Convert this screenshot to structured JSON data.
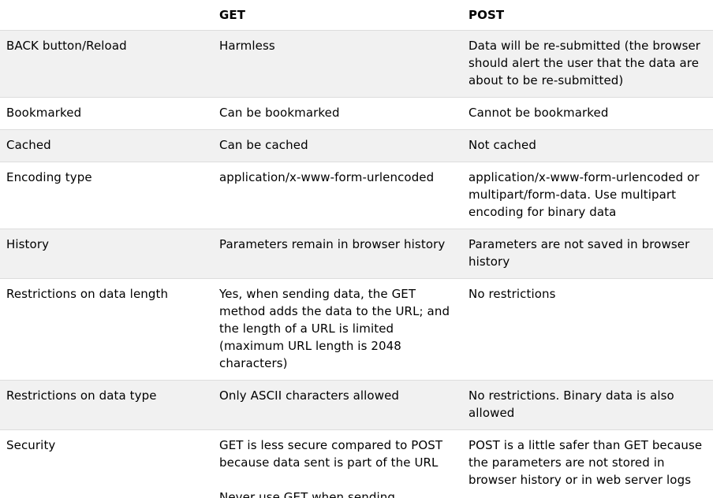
{
  "table": {
    "headers": [
      "",
      "GET",
      "POST"
    ],
    "rows": [
      {
        "label": "BACK button/Reload",
        "get": [
          "Harmless"
        ],
        "post": [
          "Data will be re-submitted (the browser should alert the user that the data are about to be re-submitted)"
        ]
      },
      {
        "label": "Bookmarked",
        "get": [
          "Can be bookmarked"
        ],
        "post": [
          "Cannot be bookmarked"
        ]
      },
      {
        "label": "Cached",
        "get": [
          "Can be cached"
        ],
        "post": [
          "Not cached"
        ]
      },
      {
        "label": "Encoding type",
        "get": [
          "application/x-www-form-urlencoded"
        ],
        "post": [
          "application/x-www-form-urlencoded or multipart/form-data. Use multipart encoding for binary data"
        ]
      },
      {
        "label": "History",
        "get": [
          "Parameters remain in browser history"
        ],
        "post": [
          "Parameters are not saved in browser history"
        ]
      },
      {
        "label": "Restrictions on data length",
        "get": [
          "Yes, when sending data, the GET method adds the data to the URL; and the length of a URL is limited (maximum URL length is 2048 characters)"
        ],
        "post": [
          "No restrictions"
        ]
      },
      {
        "label": "Restrictions on data type",
        "get": [
          "Only ASCII characters allowed"
        ],
        "post": [
          "No restrictions. Binary data is also allowed"
        ]
      },
      {
        "label": "Security",
        "get": [
          "GET is less secure compared to POST because data sent is part of the URL",
          "Never use GET when sending"
        ],
        "post": [
          "POST is a little safer than GET because the parameters are not stored in browser history or in web server logs"
        ]
      }
    ]
  }
}
